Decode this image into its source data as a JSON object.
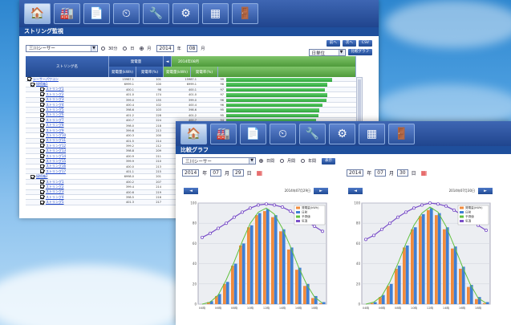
{
  "nav": {
    "items": [
      {
        "name": "home",
        "icon": "🏠"
      },
      {
        "name": "factory",
        "icon": "🏭"
      },
      {
        "name": "report",
        "icon": "📄"
      },
      {
        "name": "meter",
        "icon": "⏲"
      },
      {
        "name": "tools",
        "icon": "🔧"
      },
      {
        "name": "settings",
        "icon": "⚙"
      },
      {
        "name": "solar-panel",
        "icon": "▦"
      },
      {
        "name": "logout",
        "icon": "🚪"
      }
    ]
  },
  "win1": {
    "title": "ストリング監視",
    "select_value": "三川シーサー",
    "radios": [
      "30分",
      "日",
      "月"
    ],
    "date": {
      "year": "2014",
      "month": "08"
    },
    "right_buttons": [
      "前へ",
      "次へ",
      "CSV"
    ],
    "right_select": "日単位",
    "right_btn2": "比較グラフ",
    "headers": {
      "name": "ストリング名",
      "group": "発電量",
      "col1": "発電量(kWh)",
      "col2": "発電率(%)",
      "period": "2014年08月",
      "col3": "発電量(kWh)",
      "col4": "発電率(%)"
    },
    "rows": [
      {
        "name": "シーサーパワコン",
        "v1": "15987.1",
        "v2": "101",
        "v3": "15987.1",
        "v4": "99",
        "bar": 0.94
      },
      {
        "name": "接続箱1",
        "v1": "6999.1",
        "v2": "100",
        "v3": "6999.1",
        "v4": "98",
        "bar": 0.9
      },
      {
        "name": "ストリング1",
        "v1": "400.1",
        "v2": "98",
        "v3": "400.1",
        "v4": "97",
        "bar": 0.88
      },
      {
        "name": "ストリング2",
        "v1": "401.0",
        "v2": "174",
        "v3": "401.0",
        "v4": "97",
        "bar": 0.9
      },
      {
        "name": "ストリング3",
        "v1": "399.0",
        "v2": "155",
        "v3": "399.0",
        "v4": "96",
        "bar": 0.89
      },
      {
        "name": "ストリング4",
        "v1": "400.4",
        "v2": "102",
        "v3": "400.4",
        "v4": "96",
        "bar": 0.86
      },
      {
        "name": "ストリング5",
        "v1": "398.6",
        "v2": "103",
        "v3": "398.6",
        "v4": "95",
        "bar": 0.83
      },
      {
        "name": "ストリング6",
        "v1": "401.2",
        "v2": "228",
        "v3": "401.2",
        "v4": "95",
        "bar": 0.82
      },
      {
        "name": "ストリング7",
        "v1": "400.7",
        "v2": "224",
        "v3": "400.7",
        "v4": "94",
        "bar": 0.8
      },
      {
        "name": "ストリング8",
        "v1": "398.0",
        "v2": "218",
        "v3": "398.0",
        "v4": "94",
        "bar": 0.8
      },
      {
        "name": "ストリング9",
        "v1": "399.6",
        "v2": "213",
        "v3": "399.6",
        "v4": "93",
        "bar": 0.78
      },
      {
        "name": "ストリング10",
        "v1": "400.3",
        "v2": "200",
        "v3": "400.3",
        "v4": "93",
        "bar": 0.76
      },
      {
        "name": "ストリング11",
        "v1": "401.5",
        "v2": "214",
        "v3": "401.5",
        "v4": "92",
        "bar": 0.75
      },
      {
        "name": "ストリング12",
        "v1": "399.2",
        "v2": "212",
        "v3": "399.2",
        "v4": "92",
        "bar": 0.74
      },
      {
        "name": "ストリング13",
        "v1": "398.8",
        "v2": "209",
        "v3": "398.8",
        "v4": "91",
        "bar": 0.72
      },
      {
        "name": "ストリング14",
        "v1": "400.9",
        "v2": "211",
        "v3": "400.9",
        "v4": "91",
        "bar": 0.7
      },
      {
        "name": "ストリング15",
        "v1": "399.9",
        "v2": "210",
        "v3": "399.9",
        "v4": "90",
        "bar": 0.7
      },
      {
        "name": "ストリング16",
        "v1": "400.0",
        "v2": "213",
        "v3": "400.0",
        "v4": "90",
        "bar": 0.69
      },
      {
        "name": "ストリング17",
        "v1": "401.1",
        "v2": "215",
        "v3": "401.1",
        "v4": "89",
        "bar": 0.68
      },
      {
        "name": "接続箱2",
        "v1": "6998.0",
        "v2": "201",
        "v3": "6998.0",
        "v4": "89",
        "bar": 0.67
      },
      {
        "name": "ストリング1",
        "v1": "400.2",
        "v2": "207",
        "v3": "400.2",
        "v4": "88",
        "bar": 0.66
      },
      {
        "name": "ストリング2",
        "v1": "399.4",
        "v2": "214",
        "v3": "399.4",
        "v4": "88",
        "bar": 0.66
      },
      {
        "name": "ストリング3",
        "v1": "400.6",
        "v2": "219",
        "v3": "400.6",
        "v4": "87",
        "bar": 0.65
      },
      {
        "name": "ストリング4",
        "v1": "398.5",
        "v2": "216",
        "v3": "398.5",
        "v4": "87",
        "bar": 0.64
      },
      {
        "name": "ストリング5",
        "v1": "401.3",
        "v2": "217",
        "v3": "401.3",
        "v4": "86",
        "bar": 0.63
      }
    ]
  },
  "win2": {
    "title": "比較グラフ",
    "select_value": "三川シーサー",
    "radios": [
      "日間",
      "月間",
      "年間"
    ],
    "show_btn": "表示",
    "left_date": {
      "year": "2014",
      "month": "07",
      "day": "29"
    },
    "right_date": {
      "year": "2014",
      "month": "07",
      "day": "30"
    },
    "left_nav": {
      "prev": "◄",
      "label": "2014年07月29日",
      "next": "►"
    },
    "right_nav": {
      "prev": "◄",
      "label": "2014年07月30日",
      "next": "►"
    },
    "legend": [
      "発電量(kWh)",
      "日射",
      "予測値",
      "気温"
    ]
  },
  "colors": {
    "nav_bg": "#2a4f98",
    "header_blue": "#23498f",
    "bar_green": "#3bb849",
    "chart_orange": "#f28b3c",
    "chart_blue": "#3f7fd4",
    "chart_green": "#61c13e",
    "chart_purple": "#7a4fc8"
  },
  "chart_data": [
    {
      "type": "bar",
      "categories": [
        "04時",
        "05時",
        "06時",
        "07時",
        "08時",
        "09時",
        "10時",
        "11時",
        "12時",
        "13時",
        "14時",
        "15時",
        "16時",
        "17時",
        "18時",
        "19時"
      ],
      "series": [
        {
          "name": "発電量(kWh)",
          "values": [
            0,
            2,
            8,
            20,
            38,
            58,
            76,
            88,
            92,
            86,
            72,
            54,
            34,
            18,
            6,
            1
          ]
        },
        {
          "name": "日射",
          "values": [
            0,
            3,
            10,
            22,
            40,
            60,
            78,
            90,
            94,
            88,
            74,
            56,
            36,
            20,
            8,
            2
          ]
        },
        {
          "name": "予測値",
          "values": [
            0,
            2,
            9,
            24,
            42,
            62,
            80,
            91,
            95,
            89,
            75,
            57,
            37,
            20,
            7,
            1
          ]
        },
        {
          "name": "気温",
          "values": [
            66,
            70,
            75,
            80,
            86,
            91,
            95,
            98,
            99,
            98,
            96,
            92,
            87,
            82,
            77,
            72
          ]
        }
      ],
      "ylim": [
        0,
        100
      ]
    },
    {
      "type": "bar",
      "categories": [
        "04時",
        "05時",
        "06時",
        "07時",
        "08時",
        "09時",
        "10時",
        "11時",
        "12時",
        "13時",
        "14時",
        "15時",
        "16時",
        "17時",
        "18時",
        "19時"
      ],
      "series": [
        {
          "name": "発電量(kWh)",
          "values": [
            0,
            1,
            7,
            18,
            35,
            56,
            74,
            87,
            93,
            88,
            74,
            55,
            35,
            17,
            5,
            1
          ]
        },
        {
          "name": "日射",
          "values": [
            0,
            2,
            9,
            20,
            38,
            58,
            76,
            89,
            95,
            90,
            76,
            57,
            37,
            19,
            7,
            2
          ]
        },
        {
          "name": "予測値",
          "values": [
            0,
            2,
            8,
            22,
            40,
            60,
            78,
            90,
            96,
            91,
            77,
            58,
            38,
            20,
            6,
            1
          ]
        },
        {
          "name": "気温",
          "values": [
            64,
            68,
            74,
            80,
            86,
            91,
            95,
            98,
            100,
            99,
            97,
            93,
            88,
            83,
            78,
            73
          ]
        }
      ],
      "ylim": [
        0,
        100
      ]
    }
  ]
}
